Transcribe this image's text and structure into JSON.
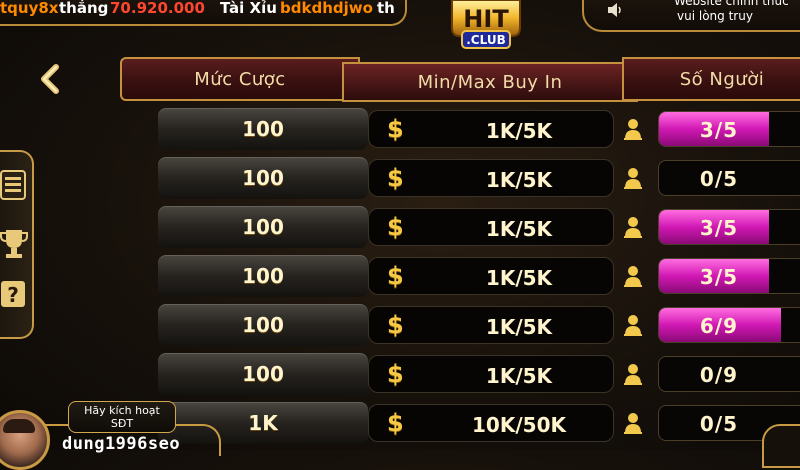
{
  "ticker": {
    "user1": "tquy8x",
    "won_label": "thắng",
    "amount": "70.920.000",
    "game": "Tài Xỉu",
    "user2": "bdkdhdjwo",
    "trail": "th",
    "message_line1": "Website chính thức",
    "message_line2": "vui lòng truy"
  },
  "logo": {
    "top_text": "HIT",
    "bottom_text": ".CLUB"
  },
  "headers": {
    "bet": "Mức Cược",
    "buyin": "Min/Max Buy In",
    "players": "Số Người"
  },
  "currency_symbol": "$",
  "rows": [
    {
      "bet": "100",
      "buyin": "1K/5K",
      "players": "3/5",
      "current": 3,
      "max": 5
    },
    {
      "bet": "100",
      "buyin": "1K/5K",
      "players": "0/5",
      "current": 0,
      "max": 5
    },
    {
      "bet": "100",
      "buyin": "1K/5K",
      "players": "3/5",
      "current": 3,
      "max": 5
    },
    {
      "bet": "100",
      "buyin": "1K/5K",
      "players": "3/5",
      "current": 3,
      "max": 5
    },
    {
      "bet": "100",
      "buyin": "1K/5K",
      "players": "6/9",
      "current": 6,
      "max": 9
    },
    {
      "bet": "100",
      "buyin": "1K/5K",
      "players": "0/9",
      "current": 0,
      "max": 9
    },
    {
      "bet": "1K",
      "buyin": "10K/50K",
      "players": "0/5",
      "current": 0,
      "max": 5
    }
  ],
  "user": {
    "activate_line1": "Hãy kích hoạt",
    "activate_line2": "SĐT",
    "username": "dung1996seo"
  },
  "colors": {
    "gold": "#c5913f",
    "header_red": "#4a1515",
    "fill_magenta": "#d118b4",
    "amount_red": "#ff4630",
    "name_orange": "#ff8a00"
  },
  "icons": [
    "speaker-icon",
    "back-chevron-icon",
    "document-list-icon",
    "trophy-icon",
    "help-icon",
    "dollar-icon",
    "person-icon"
  ]
}
